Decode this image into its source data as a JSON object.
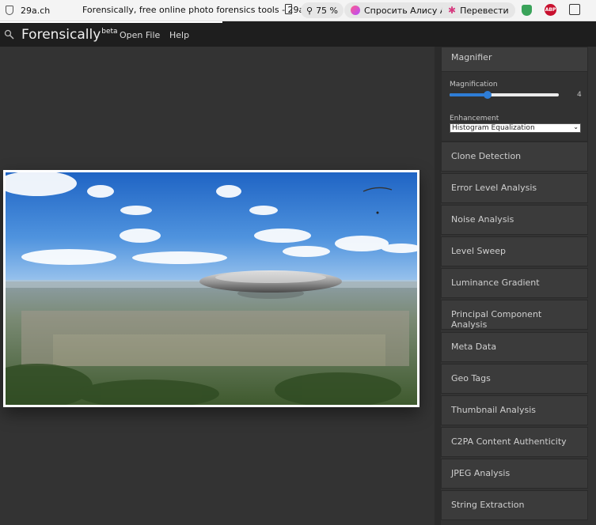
{
  "browser": {
    "domain": "29a.ch",
    "page_title": "Forensically, free online photo forensics tools - 29a.ch",
    "zoom": "75 %",
    "alisa_label": "Спросить Алису AI",
    "translate_label": "Перевести",
    "abp_label": "ABP"
  },
  "app": {
    "brand": "Forensically",
    "brand_sup": "beta",
    "menu": [
      "Open File",
      "Help"
    ]
  },
  "magnifier": {
    "title": "Magnifier",
    "magnification_label": "Magnification",
    "magnification_value": "4",
    "magnification_fraction": 0.35,
    "enhancement_label": "Enhancement",
    "enhancement_value": "Histogram Equalization"
  },
  "tools": [
    "Clone Detection",
    "Error Level Analysis",
    "Noise Analysis",
    "Level Sweep",
    "Luminance Gradient",
    "Principal Component Analysis",
    "Meta Data",
    "Geo Tags",
    "Thumbnail Analysis",
    "C2PA Content Authenticity",
    "JPEG Analysis",
    "String Extraction"
  ],
  "colors": {
    "accent": "#2e7dd6",
    "canvas_bg": "#333333",
    "panel_bg": "#3b3b3b"
  }
}
